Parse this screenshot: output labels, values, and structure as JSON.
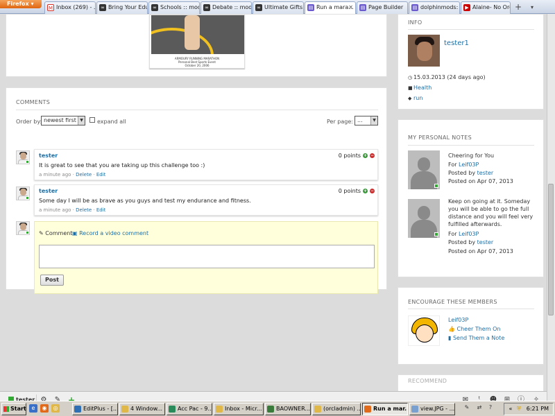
{
  "browser": {
    "menu_label": "Firefox",
    "tabs": [
      {
        "title": "Inbox (269) - ...",
        "icon": "gmail-icon",
        "color": "#d93025"
      },
      {
        "title": "Bring Your Edu...",
        "icon": "site-icon",
        "color": "#333333"
      },
      {
        "title": "Schools :: mod...",
        "icon": "site-icon",
        "color": "#333333"
      },
      {
        "title": "Debate :: mod...",
        "icon": "site-icon",
        "color": "#333333"
      },
      {
        "title": "Ultimate Gifts :...",
        "icon": "site-icon",
        "color": "#333333"
      },
      {
        "title": "Run a mara...",
        "icon": "page-icon",
        "color": "#6a5acd",
        "active": true
      },
      {
        "title": "Page Builder",
        "icon": "page-icon",
        "color": "#6a5acd"
      },
      {
        "title": "dolphinmods: I...",
        "icon": "page-icon",
        "color": "#6a5acd"
      },
      {
        "title": "Alaine- No Ord...",
        "icon": "youtube-icon",
        "color": "#cc0000"
      }
    ],
    "new_tab": "+",
    "tab_list": "▾"
  },
  "photo": {
    "caption_lines": [
      "ARMOURY RUNNING MARATHON",
      "Personal Best Sports Event",
      "October 20, 2006"
    ]
  },
  "comments": {
    "title": "COMMENTS",
    "order_by_label": "Order by:",
    "order_by_value": "newest first",
    "expand_all_label": "expand all",
    "per_page_label": "Per page:",
    "per_page_value": "...",
    "items": [
      {
        "author": "tester",
        "text": "It is great to see that you are taking up this challenge too :)",
        "time": "a minute ago",
        "delete": "Delete",
        "edit": "Edit",
        "points": "0 points"
      },
      {
        "author": "tester",
        "text": "Some day I will be as brave as you guys and test my endurance and fitness.",
        "time": "a minute ago",
        "delete": "Delete",
        "edit": "Edit",
        "points": "0 points"
      }
    ],
    "meta_sep": "·",
    "new_comment": {
      "tab_comment": "Comment",
      "tab_video": "Record a video comment",
      "textarea_value": "",
      "post_label": "Post"
    }
  },
  "info": {
    "title": "INFO",
    "username": "tester1",
    "date": "15.03.2013 (24 days ago)",
    "category": "Health",
    "tag": "run"
  },
  "notes": {
    "title": "MY PERSONAL NOTES",
    "items": [
      {
        "text": "Cheering for You",
        "for_label": "For",
        "for_user": "Leif03P",
        "posted_by_label": "Posted by",
        "posted_by": "tester",
        "posted_on": "Posted on Apr 07, 2013"
      },
      {
        "text": "Keep on going at it. Someday you will be able to go the full distance and you will feel very fulfilled afterwards.",
        "for_label": "For",
        "for_user": "Leif03P",
        "posted_by_label": "Posted by",
        "posted_by": "tester",
        "posted_on": "Posted on Apr 07, 2013"
      }
    ]
  },
  "encourage": {
    "title": "ENCOURAGE THESE MEMBERS",
    "member": "Leif03P",
    "cheer": "Cheer Them On",
    "note": "Send Them a Note"
  },
  "recommend": {
    "title": "RECOMMEND"
  },
  "social_bar": {
    "username": "tester",
    "icons": [
      "gear-icon",
      "edit-icon",
      "add-icon",
      "mail-icon",
      "twitter-icon",
      "people-icon",
      "cart-icon",
      "info-icon",
      "tools-icon"
    ]
  },
  "taskbar": {
    "start": "Start",
    "items": [
      {
        "label": "EditPlus - [...",
        "color": "#2f6fb3"
      },
      {
        "label": "4 Window...",
        "color": "#e0b84a"
      },
      {
        "label": "Acc Pac - 9...",
        "color": "#2a8a5a"
      },
      {
        "label": "Inbox - Micr...",
        "color": "#e0b84a"
      },
      {
        "label": "BAOWNER...",
        "color": "#3a7a3a"
      },
      {
        "label": "(orcladmin) ...",
        "color": "#e0b84a"
      },
      {
        "label": "Run a mar...",
        "color": "#e06a1a",
        "active": true
      },
      {
        "label": "view.JPG - ...",
        "color": "#7aa0d0"
      }
    ],
    "clock": "6:21 PM"
  },
  "colors": {
    "link": "#1c6ea4",
    "online": "#33aa33",
    "comment_form_bg": "#ffffdc"
  }
}
